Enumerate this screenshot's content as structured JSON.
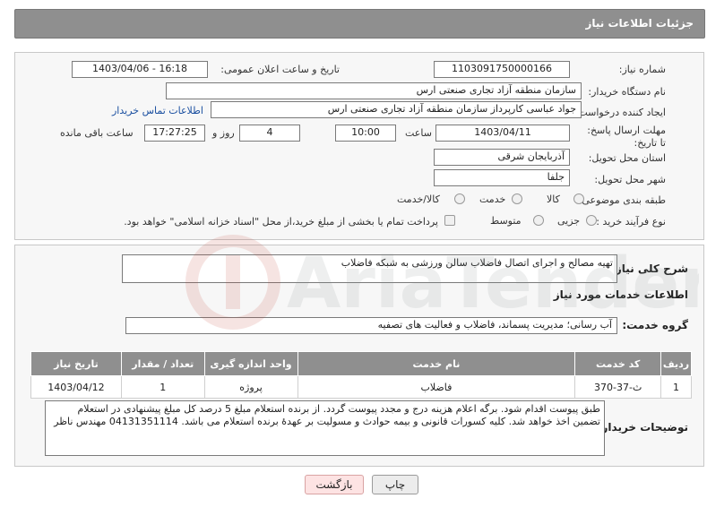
{
  "header": {
    "title": "جزئیات اطلاعات نیاز"
  },
  "form": {
    "need_number_label": "شماره نیاز:",
    "need_number": "1103091750000166",
    "announce_label": "تاریخ و ساعت اعلان عمومی:",
    "announce_value": "1403/04/06 - 16:18",
    "buyer_org_label": "نام دستگاه خریدار:",
    "buyer_org": "سازمان منطقه آزاد تجاری صنعتی ارس",
    "creator_label": "ایجاد کننده درخواست:",
    "creator": "جواد عباسی کارپرداز سازمان منطقه آزاد تجاری صنعتی ارس",
    "contact_link": "اطلاعات تماس خریدار",
    "deadline_label": "مهلت ارسال پاسخ: تا تاریخ:",
    "deadline_date": "1403/04/11",
    "time_label": "ساعت",
    "deadline_time": "10:00",
    "days_value": "4",
    "days_label": "روز و",
    "remaining_time": "17:27:25",
    "remaining_label": "ساعت باقی مانده",
    "province_label": "استان محل تحویل:",
    "province": "آذربایجان شرقی",
    "city_label": "شهر محل تحویل:",
    "city": "جلفا",
    "category_label": "طبقه بندی موضوعی:",
    "category_options": [
      "کالا",
      "خدمت",
      "کالا/خدمت"
    ],
    "process_label": "نوع فرآیند خرید :",
    "process_options": [
      "جزیی",
      "متوسط"
    ],
    "payment_note": "پرداخت تمام یا بخشی از مبلغ خرید،از محل \"اسناد خزانه اسلامی\" خواهد بود."
  },
  "details": {
    "summary_label": "شرح کلی نیاز:",
    "summary": "تهیه مصالح و اجرای اتصال فاضلاب سالن ورزشی به شبکه فاضلاب",
    "services_heading": "اطلاعات خدمات مورد نیاز",
    "service_group_label": "گروه خدمت:",
    "service_group": "آب رسانی؛ مدیریت پسماند، فاضلاب و فعالیت های تصفیه",
    "table": {
      "headers": [
        "ردیف",
        "کد خدمت",
        "نام خدمت",
        "واحد اندازه گیری",
        "تعداد / مقدار",
        "تاریخ نیاز"
      ],
      "rows": [
        [
          "1",
          "ث-37-370",
          "فاضلاب",
          "پروژه",
          "1",
          "1403/04/12"
        ]
      ]
    },
    "buyer_notes_label": "توضیحات خریدار:",
    "buyer_notes": "طبق پیوست اقدام شود. برگه اعلام هزینه درج و مجدد پیوست گردد. از برنده استعلام مبلغ 5 درصد کل مبلغ پیشنهادی در استعلام تضمین اخذ خواهد شد. کلیه کسورات قانونی و بیمه حوادث و مسولیت بر عهدهٔ برنده استعلام می باشد. 04131351114 مهندس ناظر"
  },
  "buttons": {
    "print": "چاپ",
    "back": "بازگشت"
  },
  "watermark": {
    "text": "AriaTender.net"
  },
  "colors": {
    "header": "#8f8f8f",
    "link": "#1a4fa0",
    "back_button_bg": "#fde3e3"
  }
}
